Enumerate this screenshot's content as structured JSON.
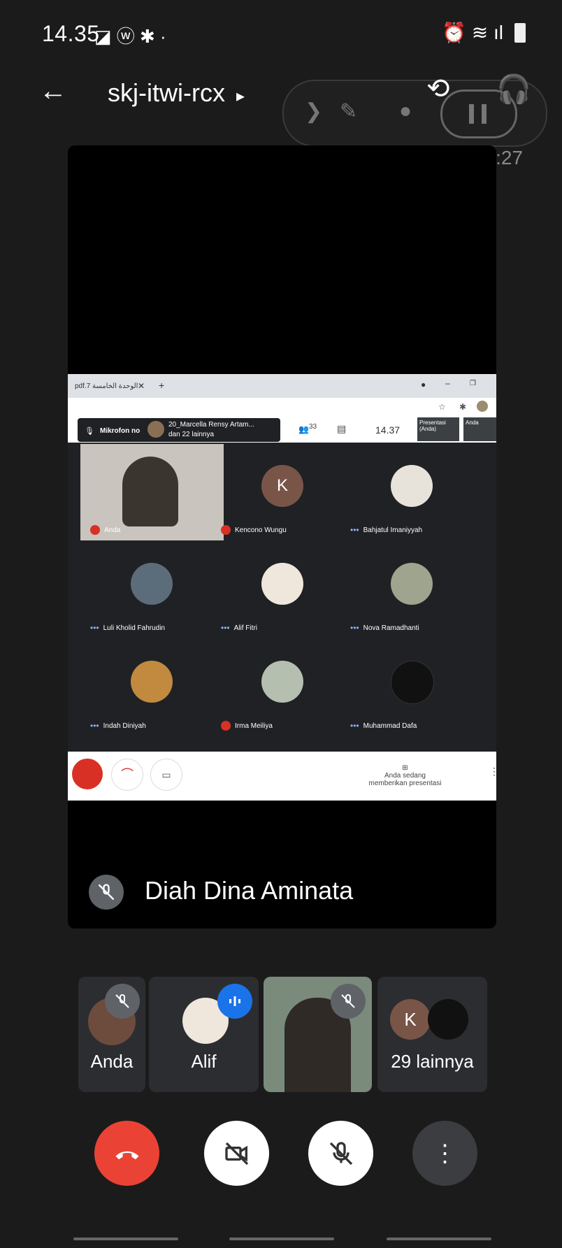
{
  "status_bar": {
    "time": "14.35",
    "left_icons": "◪ ⓦ  ✱ ·",
    "right_icons": "⏰ ≋ ıl"
  },
  "header": {
    "meeting_code": "skj-itwi-rcx",
    "caret": "▸",
    "recording_time": "12:27"
  },
  "shared_screen": {
    "tab_label": "pdf.الوحدة الخامسة 7",
    "mic_notice": "Mikrofon no",
    "presenter_notice_line1": "20_Marcella Rensy Artam...",
    "presenter_notice_line2": "dan 22 lainnya",
    "people_count": "33",
    "clock": "14.37",
    "presentation_label": "Presentasi (Anda)",
    "self_label": "Anda",
    "presenting_text": "Anda sedang memberikan presentasi",
    "tiles": [
      {
        "name": "Anda",
        "status": "muted"
      },
      {
        "name": "Kencono Wungu",
        "status": "muted",
        "initial": "K"
      },
      {
        "name": "Bahjatul Imaniyyah",
        "status": "dots"
      },
      {
        "name": "Luli Kholid Fahrudin",
        "status": "dots"
      },
      {
        "name": "Alif Fitri",
        "status": "dots"
      },
      {
        "name": "Nova Ramadhanti",
        "status": "dots"
      },
      {
        "name": "Indah Diniyah",
        "status": "dots"
      },
      {
        "name": "Irma Meiliya",
        "status": "muted"
      },
      {
        "name": "Muhammad Dafa",
        "status": "dots"
      }
    ]
  },
  "main_speaker": {
    "name": "Diah Dina Aminata"
  },
  "participant_strip": [
    {
      "label": "Anda"
    },
    {
      "label": "Alif"
    },
    {
      "label": ""
    },
    {
      "label": "29 lainnya",
      "initial": "K"
    }
  ],
  "colors": {
    "accent_red": "#ea4335",
    "speaking_blue": "#1a73e8",
    "card_bg": "#2c2d30"
  }
}
